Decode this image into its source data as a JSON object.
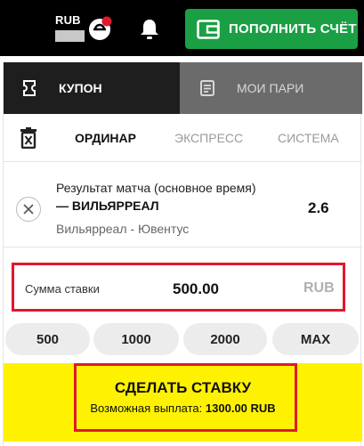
{
  "header": {
    "currency": "RUB",
    "deposit_label": "ПОПОЛНИТЬ СЧЁТ",
    "icons": [
      "user-icon",
      "bell-icon",
      "wallet-icon"
    ],
    "colors": {
      "deposit_bg": "#1b9f45",
      "notification_dot": "#e0182d"
    }
  },
  "tabs": [
    {
      "label": "КУПОН",
      "icon": "coupon-icon",
      "active": true
    },
    {
      "label": "МОИ ПАРИ",
      "icon": "document-icon",
      "active": false
    }
  ],
  "bet_types": [
    "ОРДИНАР",
    "ЭКСПРЕСС",
    "СИСТЕМА"
  ],
  "selection": {
    "market": "Результат матча (основное время)",
    "outcome": "— ВИЛЬЯРРЕАЛ",
    "event": "Вильярреал - Ювентус",
    "odds": "2.6"
  },
  "stake": {
    "label": "Сумма ставки",
    "value": "500.00",
    "currency": "RUB"
  },
  "quick_amounts": [
    "500",
    "1000",
    "2000",
    "MAX"
  ],
  "place_bet": {
    "label": "СДЕЛАТЬ СТАВКУ",
    "payout_label": "Возможная выплата:",
    "payout_value": "1300.00 RUB",
    "bg_color": "#fff200",
    "highlight_color": "#e0182d"
  }
}
